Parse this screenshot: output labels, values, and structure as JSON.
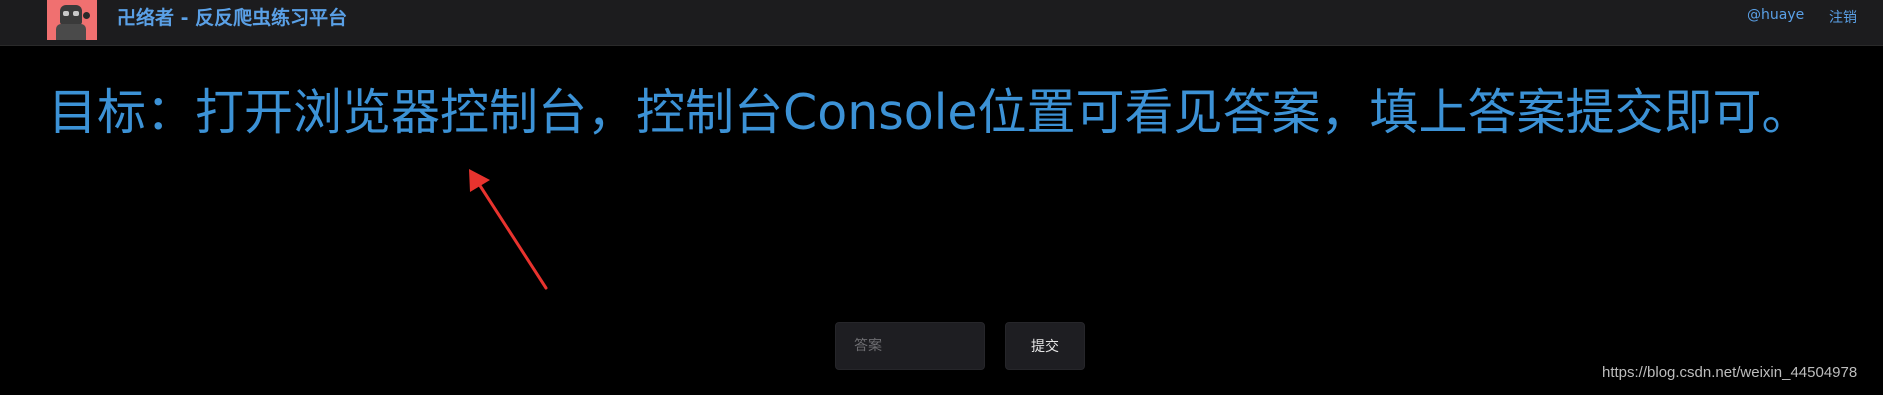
{
  "header": {
    "brand": "卍络者 - 反反爬虫练习平台",
    "user": "@huaye",
    "logout": "注销"
  },
  "main": {
    "goal": "目标：打开浏览器控制台，控制台Console位置可看见答案，填上答案提交即可。",
    "answer_placeholder": "答案",
    "answer_value": "",
    "submit_label": "提交"
  },
  "watermark": "https://blog.csdn.net/weixin_44504978",
  "colors": {
    "accent": "#3c92d6",
    "arrow": "#e8332e",
    "background": "#000000",
    "navbar": "#1c1c1e"
  }
}
